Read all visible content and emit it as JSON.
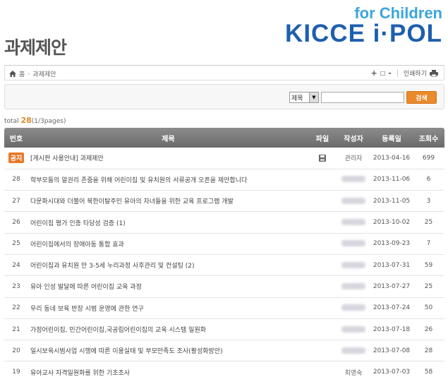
{
  "logo": {
    "top_text": "for Children",
    "main_text": "KICCE i·POL"
  },
  "page_title": "과제제안",
  "breadcrumb": {
    "home": "홈",
    "current": "과제제안"
  },
  "toolbar": {
    "zoom_in": "+",
    "zoom_reset": "□",
    "zoom_out": "-",
    "print_label": "인쇄하기"
  },
  "search": {
    "select_value": "제목",
    "input_value": "",
    "button_label": "검색"
  },
  "total": {
    "prefix": "total",
    "count": "28",
    "pages": "(1/3pages)"
  },
  "table": {
    "headers": {
      "no": "번호",
      "title": "제목",
      "file": "파일",
      "author": "작성자",
      "date": "등록일",
      "views": "조회수"
    },
    "notice": {
      "badge": "공지",
      "title": "[게시판 사용안내] 과제제안",
      "author": "관리자",
      "date": "2013-04-16",
      "views": "699"
    },
    "rows": [
      {
        "no": "28",
        "title": "학부모들의 알권리 존중을 위해 어린이집 및 유치원의 서류공개 오픈을 제안합니다",
        "date": "2013-11-06",
        "views": "6"
      },
      {
        "no": "27",
        "title": "다문화시대와 더불어 북한이탈주민 유아의 자녀들을 위한 교육 프로그램 개발",
        "date": "2013-11-05",
        "views": "3"
      },
      {
        "no": "26",
        "title": "어린이집 평가 인증 타당성 검증 (1)",
        "date": "2013-10-02",
        "views": "25"
      },
      {
        "no": "25",
        "title": "어린이집에서의 장애아동 통합 효과",
        "date": "2013-09-23",
        "views": "7"
      },
      {
        "no": "24",
        "title": "어린이집과 유치원 만 3-5세 누리과정 사후관리 및 컨설팅  (2)",
        "date": "2013-07-31",
        "views": "59"
      },
      {
        "no": "23",
        "title": "유아 인성 발달에 따른 어린이집 교육 과정",
        "date": "2013-07-27",
        "views": "25"
      },
      {
        "no": "22",
        "title": "우리 동네 보육 반장 시범 운영에 관한 연구",
        "date": "2013-07-24",
        "views": "50"
      },
      {
        "no": "21",
        "title": "가정어린이집, 민간어린이집,국공립어린이집의 교육 시스템 일원화",
        "date": "2013-07-18",
        "views": "26"
      },
      {
        "no": "20",
        "title": "일시보육시범사업 시행에 따른 이용실태 및 부모만족도 조사(활성화방안)",
        "date": "2013-07-08",
        "views": "28"
      },
      {
        "no": "19",
        "title": "유아교사 자격일원화를 위한 기초조사",
        "author": "최영숙",
        "date": "2013-07-03",
        "views": "58"
      }
    ]
  }
}
